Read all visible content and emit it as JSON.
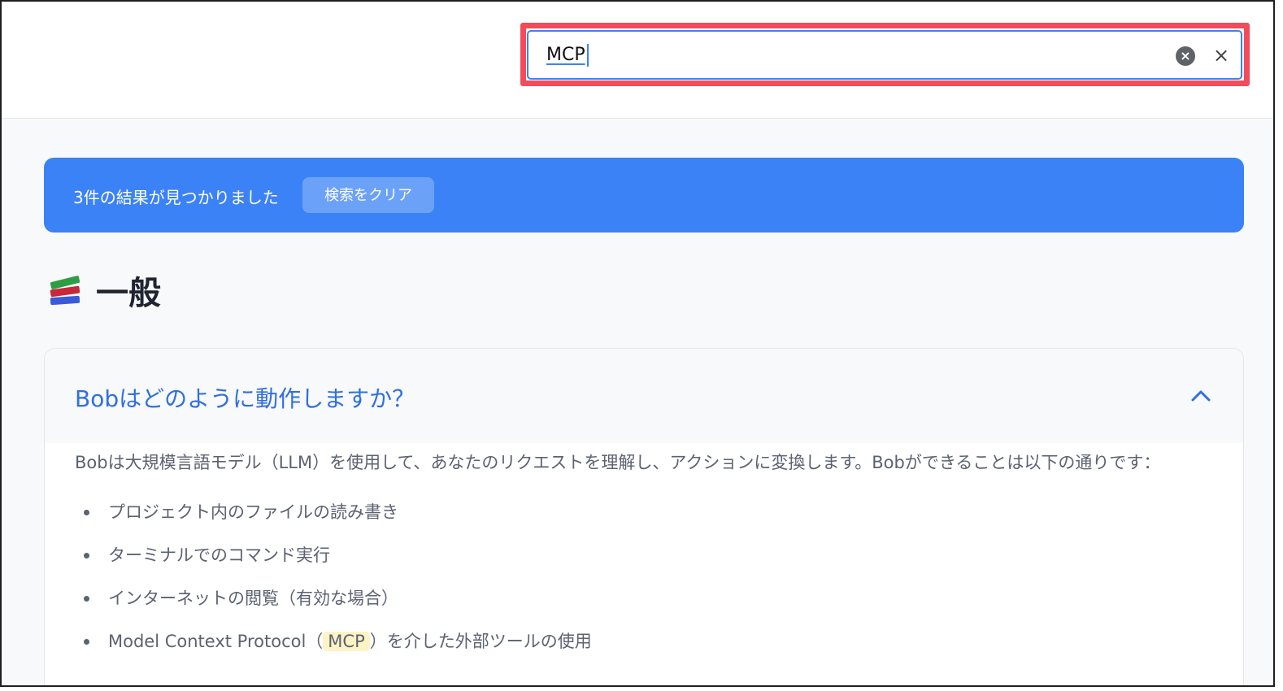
{
  "search": {
    "value": "MCP",
    "clear_icon": "x-circle-icon",
    "close_icon": "close-icon",
    "accent_color": "#3b82f6",
    "highlight_color": "#f24b5b"
  },
  "banner": {
    "text": "3件の結果が見つかりました",
    "clear_button": "検索をクリア",
    "color": "#3b82f6"
  },
  "section": {
    "icon": "books-icon",
    "title": "一般"
  },
  "faq": {
    "question": "Bobはどのように動作しますか？",
    "expanded_icon": "chevron-up-icon",
    "answer": "Bobは大規模言語モデル（LLM）を使用して、あなたのリクエストを理解し、アクションに変換します。Bobができることは以下の通りです：",
    "items": [
      "プロジェクト内のファイルの読み書き",
      "ターミナルでのコマンド実行",
      "インターネットの閲覧（有効な場合）"
    ],
    "last_item": {
      "before": "Model Context Protocol（",
      "highlight": "MCP",
      "after": "）を介した外部ツールの使用"
    }
  }
}
